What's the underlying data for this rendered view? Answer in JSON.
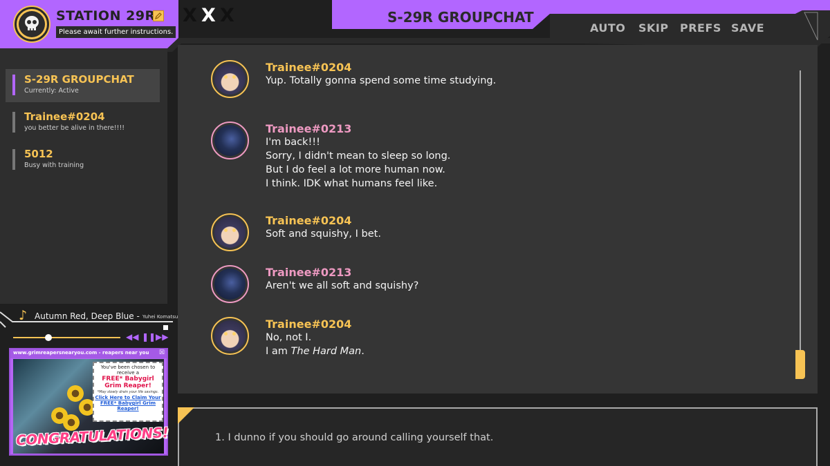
{
  "app": {
    "station_title": "STATION 29R",
    "status_message": "Please await further instructions.",
    "x_marks": [
      "X",
      "X",
      "X"
    ],
    "chat_title": "S-29R GROUPCHAT"
  },
  "menu": [
    "AUTO",
    "SKIP",
    "PREFS",
    "SAVE"
  ],
  "sidebar": {
    "contacts": [
      {
        "name": "S-29R GROUPCHAT",
        "status": "Currently: Active"
      },
      {
        "name": "Trainee#0204",
        "status": "you better be alive in there!!!!"
      },
      {
        "name": "5012",
        "status": "Busy with training"
      }
    ]
  },
  "music": {
    "track": "Autumn Red, Deep Blue -",
    "artist": "Yuhei Komatsu",
    "progress": 0.33,
    "controls": [
      "◀◀",
      "❚❚",
      "▶▶"
    ]
  },
  "ad": {
    "url": "www.grimreapersnearyou.com - reapers near you",
    "close": "☒",
    "chosen": "You've been chosen to receive a",
    "offer": "FREE* Babygirl Grim Reaper!",
    "disclaimer": "*May slowly drain your life savings.",
    "claim": "Click Here to Claim Your FREE* Babygirl Grim Reaper!",
    "congrats": "CONGRATULATIONS!"
  },
  "messages": [
    {
      "sender": "Trainee#0204",
      "text": "Yup. Totally gonna spend some time studying."
    },
    {
      "sender": "Trainee#0213",
      "text": "I'm back!!!\nSorry, I didn't mean to sleep so long.\nBut I do feel a lot more human now.\nI think. IDK what humans feel like."
    },
    {
      "sender": "Trainee#0204",
      "text": "Soft and squishy, I bet."
    },
    {
      "sender": "Trainee#0213",
      "text": "Aren't we all soft and squishy?"
    },
    {
      "sender": "Trainee#0204",
      "text_line1": "No, not I.",
      "text_line2_prefix": "I am ",
      "text_line2_italic": "The Hard Man",
      "text_line2_suffix": "."
    }
  ],
  "reply_option": "1. I dunno if you should go around calling yourself that.",
  "colors": {
    "accent_purple": "#b266ff",
    "accent_yellow": "#f7c354",
    "accent_pink": "#ee9ac2",
    "panel": "#353535"
  }
}
